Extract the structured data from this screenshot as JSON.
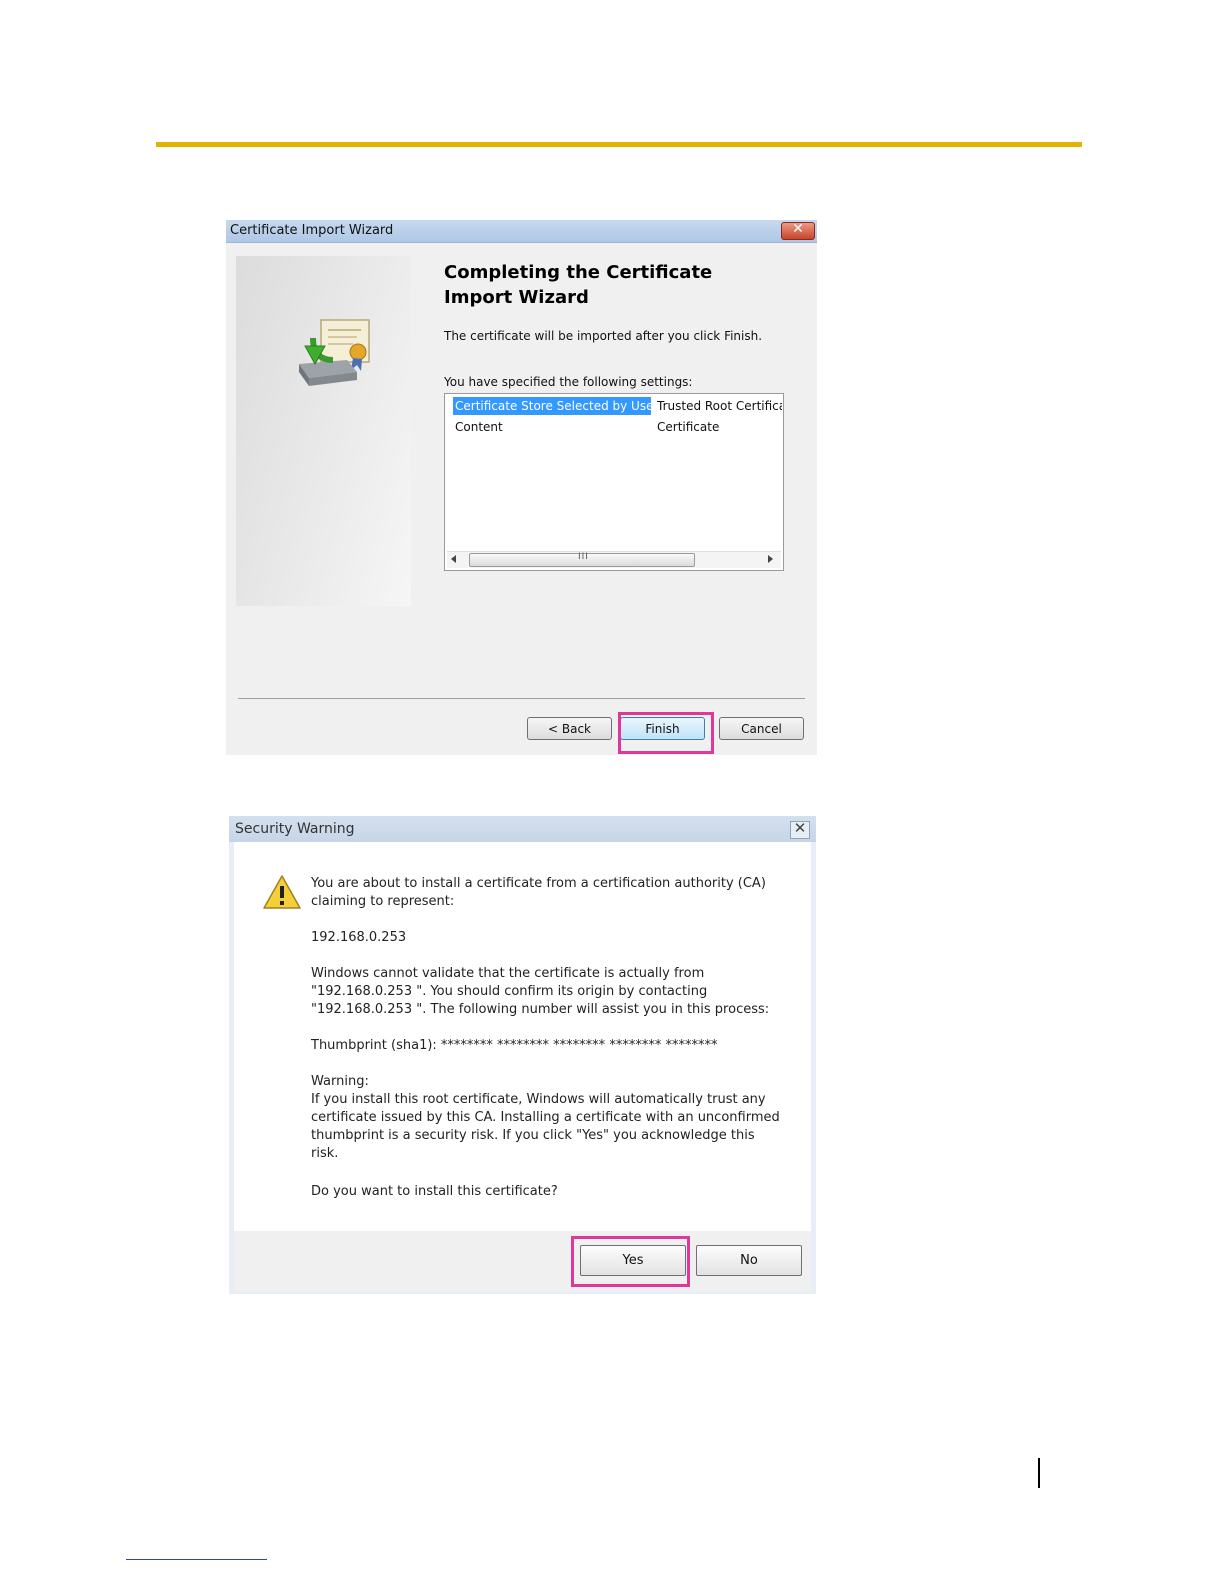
{
  "wizard": {
    "title": "Certificate Import Wizard",
    "close_glyph": "✕",
    "heading": "Completing the Certificate Import Wizard",
    "message": "The certificate will be imported after you click Finish.",
    "settings_label": "You have specified the following settings:",
    "settings": [
      {
        "key": "Certificate Store Selected by User",
        "value": "Trusted Root Certification Authorities",
        "selected": true
      },
      {
        "key": "Content",
        "value": "Certificate",
        "selected": false
      }
    ],
    "scroll_grip": "III",
    "buttons": {
      "back": "< Back",
      "finish": "Finish",
      "cancel": "Cancel"
    }
  },
  "security_warning": {
    "title": "Security Warning",
    "close_glyph": "✕",
    "intro": "You are about to install a certificate from a certification authority (CA) claiming to represent:",
    "host": "192.168.0.253",
    "validate_text": "Windows cannot validate that the certificate is actually from \"192.168.0.253 \". You should confirm its origin by contacting \"192.168.0.253 \". The following number will assist you in this process:",
    "thumbprint": "Thumbprint (sha1): ******** ******** ******** ******** ********",
    "warning_label": "Warning:",
    "warning_text": "If you install this root certificate, Windows will automatically trust any certificate issued by this CA. Installing a certificate with an unconfirmed thumbprint is a security risk. If you click \"Yes\" you acknowledge this risk.",
    "question": "Do you want to install this certificate?",
    "buttons": {
      "yes": "Yes",
      "no": "No"
    }
  },
  "colors": {
    "rule": "#e0b400",
    "highlight": "#e0379b",
    "selection": "#3399ff"
  },
  "icons": [
    "certificate-import-icon",
    "warning-icon",
    "close-icon",
    "scroll-left-icon",
    "scroll-right-icon"
  ]
}
